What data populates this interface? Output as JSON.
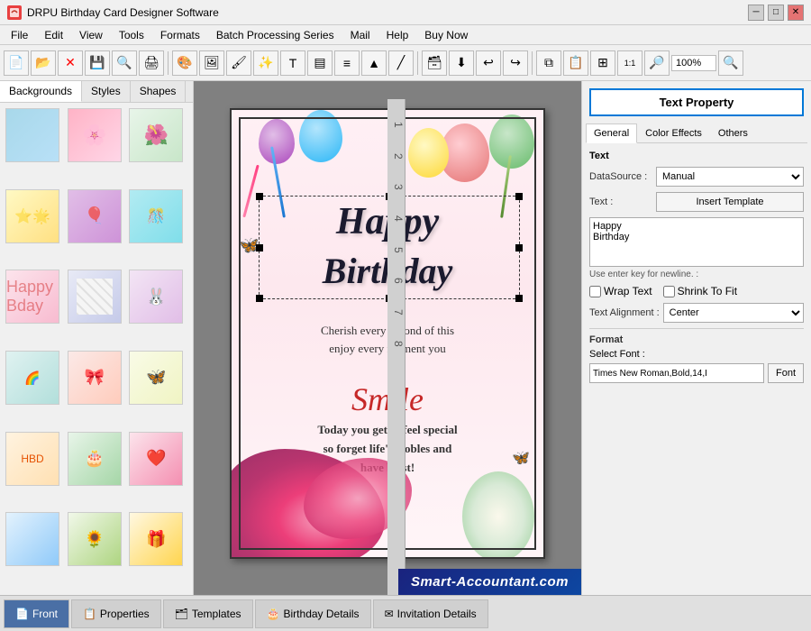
{
  "titleBar": {
    "title": "DRPU Birthday Card Designer Software",
    "controls": [
      "minimize",
      "maximize",
      "close"
    ]
  },
  "menuBar": {
    "items": [
      "File",
      "Edit",
      "View",
      "Tools",
      "Formats",
      "Batch Processing Series",
      "Mail",
      "Help",
      "Buy Now"
    ]
  },
  "leftPanel": {
    "tabs": [
      "Backgrounds",
      "Styles",
      "Shapes"
    ],
    "activeTab": "Backgrounds"
  },
  "rightPanel": {
    "title": "Text Property",
    "tabs": [
      "General",
      "Color Effects",
      "Others"
    ],
    "activeTab": "General",
    "text": {
      "label": "Text",
      "dataSourceLabel": "DataSource :",
      "dataSourceValue": "Manual",
      "textLabel": "Text :",
      "insertTemplateBtn": "Insert Template",
      "textAreaValue": "Happy\nBirthday",
      "hintText": "Use enter key for newline. :",
      "wrapText": "Wrap Text",
      "shrinkToFit": "Shrink To Fit",
      "textAlignmentLabel": "Text Alignment :",
      "textAlignmentValue": "Center"
    },
    "format": {
      "label": "Format",
      "selectFontLabel": "Select Font :",
      "fontValue": "Times New Roman,Bold,14,I",
      "fontBtn": "Font"
    }
  },
  "card": {
    "happyText": "Happy",
    "birthdayText": "Birthday",
    "cherishText": "Cherish every second of this\nenjoy every moment you",
    "smileText": "Smile",
    "todayText": "Today you get to feel special\nso forget life's trobles and\nhave blast!"
  },
  "bottomTabs": {
    "items": [
      "Front",
      "Properties",
      "Templates",
      "Birthday Details",
      "Invitation Details"
    ],
    "activeTab": "Front"
  },
  "watermark": "Smart-Accountant.com",
  "toolbar": {
    "zoomLevel": "100%"
  }
}
